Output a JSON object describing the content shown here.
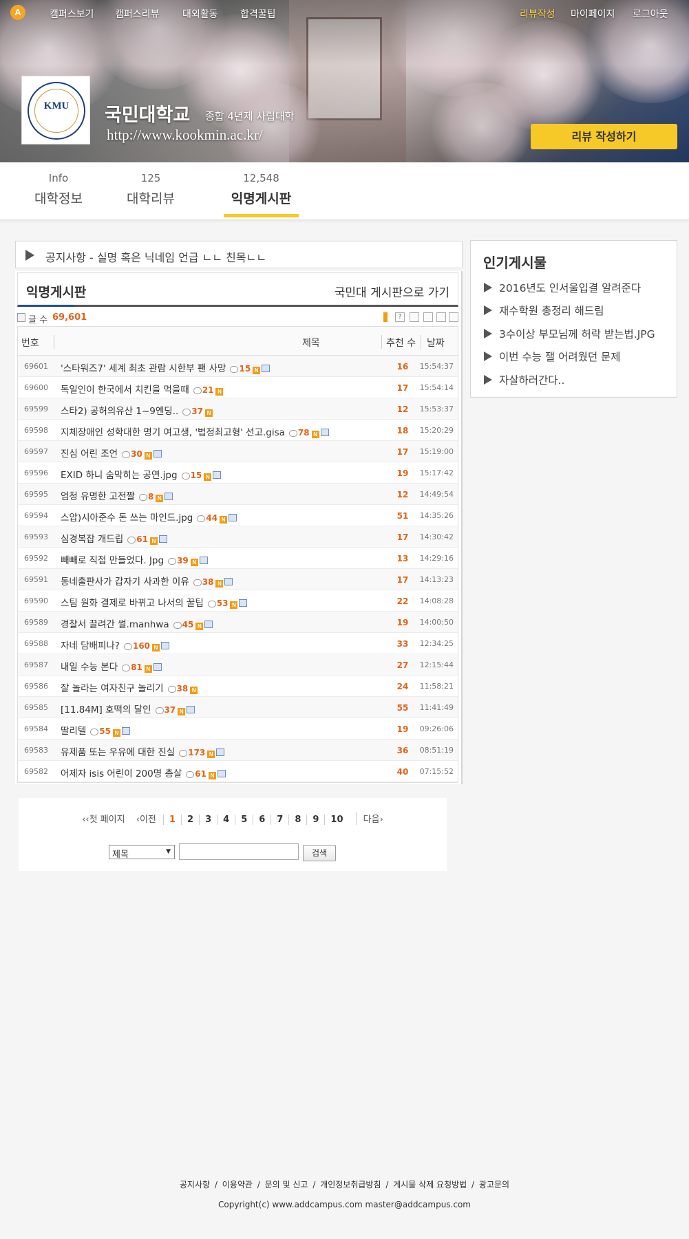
{
  "topnav": {
    "logo": "A",
    "left": [
      "캠퍼스보기",
      "캠퍼스리뷰",
      "대외활동",
      "합격꿀팁"
    ],
    "right": [
      "리뷰작성",
      "마이페이지",
      "로그아웃"
    ]
  },
  "university": {
    "logo_text": "KMU",
    "name": "국민대학교",
    "type": "종합 4년제 사립대학",
    "url": "http://www.kookmin.ac.kr/",
    "review_button": "리뷰 작성하기"
  },
  "tabs": [
    {
      "count": "Info",
      "label": "대학정보"
    },
    {
      "count": "125",
      "label": "대학리뷰"
    },
    {
      "count": "12,548",
      "label": "익명게시판"
    }
  ],
  "notice": "공지사항  - 실명 혹은 닉네임 언급 ㄴㄴ 친목ㄴㄴ",
  "board": {
    "title": "익명게시판",
    "goto": "국민대 게시판으로 가기",
    "count_label": "글 수",
    "count": "69,601",
    "headers": {
      "no": "번호",
      "title": "제목",
      "rec": "추천 수",
      "date": "날짜"
    },
    "rows": [
      {
        "no": "69601",
        "title": "'스타워즈7' 세계 최초 관람 시한부 팬 사망",
        "cmt": "15",
        "img": true,
        "rec": "16",
        "time": "15:54:37"
      },
      {
        "no": "69600",
        "title": "독일인이 한국에서 치킨을 먹을때",
        "cmt": "21",
        "img": false,
        "rec": "17",
        "time": "15:54:14"
      },
      {
        "no": "69599",
        "title": "스타2) 공허의유산 1~9엔딩..",
        "cmt": "37",
        "img": false,
        "rec": "12",
        "time": "15:53:37"
      },
      {
        "no": "69598",
        "title": "지체장애인 성학대한 명기 여고생, '법정최고형' 선고.gisa",
        "cmt": "78",
        "img": true,
        "rec": "18",
        "time": "15:20:29"
      },
      {
        "no": "69597",
        "title": "진심 어린 조언",
        "cmt": "30",
        "img": true,
        "rec": "17",
        "time": "15:19:00"
      },
      {
        "no": "69596",
        "title": "EXID 하니 숨막히는 공연.jpg",
        "cmt": "15",
        "img": true,
        "rec": "19",
        "time": "15:17:42"
      },
      {
        "no": "69595",
        "title": "엄청 유명한 고전짤",
        "cmt": "8",
        "img": true,
        "rec": "12",
        "time": "14:49:54"
      },
      {
        "no": "69594",
        "title": "스압)시아준수 돈 쓰는 마인드.jpg",
        "cmt": "44",
        "img": true,
        "rec": "51",
        "time": "14:35:26"
      },
      {
        "no": "69593",
        "title": "심경복잡 개드립",
        "cmt": "61",
        "img": true,
        "rec": "17",
        "time": "14:30:42"
      },
      {
        "no": "69592",
        "title": "빼빼로 직접 만들었다. Jpg",
        "cmt": "39",
        "img": true,
        "rec": "13",
        "time": "14:29:16"
      },
      {
        "no": "69591",
        "title": "동네출판사가 갑자기 사과한 이유",
        "cmt": "38",
        "img": true,
        "rec": "17",
        "time": "14:13:23"
      },
      {
        "no": "69590",
        "title": "스팀 원화 결제로 바뀌고 나서의 꿀팁",
        "cmt": "53",
        "img": true,
        "rec": "22",
        "time": "14:08:28"
      },
      {
        "no": "69589",
        "title": "경찰서 끌려간 썰.manhwa",
        "cmt": "45",
        "img": true,
        "rec": "19",
        "time": "14:00:50"
      },
      {
        "no": "69588",
        "title": "자네 담배피나?",
        "cmt": "160",
        "img": true,
        "rec": "33",
        "time": "12:34:25"
      },
      {
        "no": "69587",
        "title": "내일 수능 본다",
        "cmt": "81",
        "img": true,
        "rec": "27",
        "time": "12:15:44"
      },
      {
        "no": "69586",
        "title": "잘 놀라는 여자친구 놀리기",
        "cmt": "38",
        "img": false,
        "rec": "24",
        "time": "11:58:21"
      },
      {
        "no": "69585",
        "title": "[11.84M] 호떡의 달인",
        "cmt": "37",
        "img": true,
        "rec": "55",
        "time": "11:41:49"
      },
      {
        "no": "69584",
        "title": "딸리텔",
        "cmt": "55",
        "img": true,
        "rec": "19",
        "time": "09:26:06"
      },
      {
        "no": "69583",
        "title": "유제품 또는 우유에 대한 진실",
        "cmt": "173",
        "img": true,
        "rec": "36",
        "time": "08:51:19"
      },
      {
        "no": "69582",
        "title": "어제자 isis 어린이 200명 총살",
        "cmt": "61",
        "img": true,
        "rec": "40",
        "time": "07:15:52"
      }
    ]
  },
  "pager": {
    "first": "첫 페이지",
    "prev": "이전",
    "pages": [
      "1",
      "2",
      "3",
      "4",
      "5",
      "6",
      "7",
      "8",
      "9",
      "10"
    ],
    "current": "1",
    "next": "다음",
    "search_select": "제목",
    "search_button": "검색"
  },
  "sidebar": {
    "title": "인기게시물",
    "items": [
      "2016년도 인서울입결 알려준다",
      "재수학원 총정리 해드림",
      "3수이상 부모님께 허락 받는법.JPG",
      "이번 수능 잴 어려웠던 문제",
      "자살하러간다.."
    ]
  },
  "footer": {
    "links": [
      "공지사항",
      "이용약관",
      "문의 및 신고",
      "개인정보취급방침",
      "게시물 삭제 요청방법",
      "광고문의"
    ],
    "copyright": "Copyright(c) www.addcampus.com    master@addcampus.com"
  },
  "colors": {
    "accent": "#f7c928",
    "highlight": "#e2631b",
    "board_underline": "#1e4fa3"
  }
}
